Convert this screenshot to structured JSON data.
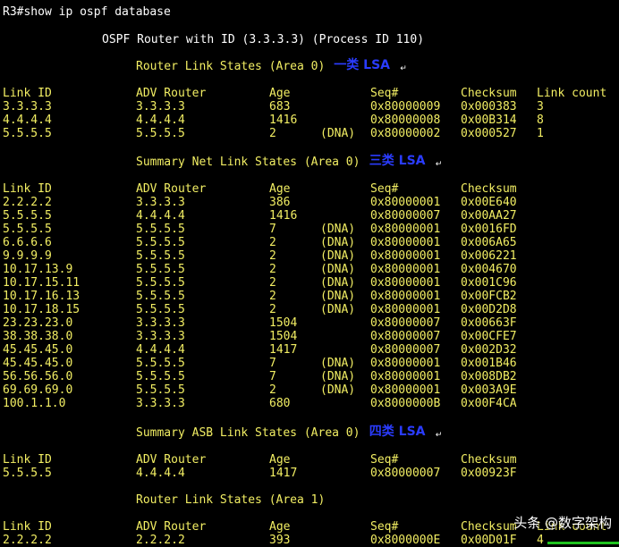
{
  "prompt": "R3#show ip ospf database",
  "title": "OSPF Router with ID (3.3.3.3) (Process ID 110)",
  "mark": "↵",
  "watermark": "头条 @数字架构",
  "sections": [
    {
      "heading": "Router Link States (Area 0)",
      "note": "一类 LSA",
      "columns": [
        "Link ID",
        "ADV Router",
        "Age",
        "Seq#",
        "Checksum",
        "Link count"
      ],
      "rows": [
        {
          "link_id": "3.3.3.3",
          "adv": "3.3.3.3",
          "age": "683",
          "dna": "",
          "seq": "0x80000009",
          "checksum": "0x000383",
          "count": "3"
        },
        {
          "link_id": "4.4.4.4",
          "adv": "4.4.4.4",
          "age": "1416",
          "dna": "",
          "seq": "0x80000008",
          "checksum": "0x00B314",
          "count": "8"
        },
        {
          "link_id": "5.5.5.5",
          "adv": "5.5.5.5",
          "age": "2",
          "dna": "(DNA)",
          "seq": "0x80000002",
          "checksum": "0x000527",
          "count": "1"
        }
      ]
    },
    {
      "heading": "Summary Net Link States (Area 0)",
      "note": "三类 LSA",
      "columns": [
        "Link ID",
        "ADV Router",
        "Age",
        "Seq#",
        "Checksum"
      ],
      "rows": [
        {
          "link_id": "2.2.2.2",
          "adv": "3.3.3.3",
          "age": "386",
          "dna": "",
          "seq": "0x80000001",
          "checksum": "0x00E640"
        },
        {
          "link_id": "5.5.5.5",
          "adv": "4.4.4.4",
          "age": "1416",
          "dna": "",
          "seq": "0x80000007",
          "checksum": "0x00AA27"
        },
        {
          "link_id": "5.5.5.5",
          "adv": "5.5.5.5",
          "age": "7",
          "dna": "(DNA)",
          "seq": "0x80000001",
          "checksum": "0x0016FD"
        },
        {
          "link_id": "6.6.6.6",
          "adv": "5.5.5.5",
          "age": "2",
          "dna": "(DNA)",
          "seq": "0x80000001",
          "checksum": "0x006A65"
        },
        {
          "link_id": "9.9.9.9",
          "adv": "5.5.5.5",
          "age": "2",
          "dna": "(DNA)",
          "seq": "0x80000001",
          "checksum": "0x006221"
        },
        {
          "link_id": "10.17.13.9",
          "adv": "5.5.5.5",
          "age": "2",
          "dna": "(DNA)",
          "seq": "0x80000001",
          "checksum": "0x004670"
        },
        {
          "link_id": "10.17.15.11",
          "adv": "5.5.5.5",
          "age": "2",
          "dna": "(DNA)",
          "seq": "0x80000001",
          "checksum": "0x001C96"
        },
        {
          "link_id": "10.17.16.13",
          "adv": "5.5.5.5",
          "age": "2",
          "dna": "(DNA)",
          "seq": "0x80000001",
          "checksum": "0x00FCB2"
        },
        {
          "link_id": "10.17.18.15",
          "adv": "5.5.5.5",
          "age": "2",
          "dna": "(DNA)",
          "seq": "0x80000001",
          "checksum": "0x00D2D8"
        },
        {
          "link_id": "23.23.23.0",
          "adv": "3.3.3.3",
          "age": "1504",
          "dna": "",
          "seq": "0x80000007",
          "checksum": "0x00663F"
        },
        {
          "link_id": "38.38.38.0",
          "adv": "3.3.3.3",
          "age": "1504",
          "dna": "",
          "seq": "0x80000007",
          "checksum": "0x00CFE7"
        },
        {
          "link_id": "45.45.45.0",
          "adv": "4.4.4.4",
          "age": "1417",
          "dna": "",
          "seq": "0x80000007",
          "checksum": "0x002D32"
        },
        {
          "link_id": "45.45.45.0",
          "adv": "5.5.5.5",
          "age": "7",
          "dna": "(DNA)",
          "seq": "0x80000001",
          "checksum": "0x001B46"
        },
        {
          "link_id": "56.56.56.0",
          "adv": "5.5.5.5",
          "age": "7",
          "dna": "(DNA)",
          "seq": "0x80000001",
          "checksum": "0x008DB2"
        },
        {
          "link_id": "69.69.69.0",
          "adv": "5.5.5.5",
          "age": "2",
          "dna": "(DNA)",
          "seq": "0x80000001",
          "checksum": "0x003A9E"
        },
        {
          "link_id": "100.1.1.0",
          "adv": "3.3.3.3",
          "age": "680",
          "dna": "",
          "seq": "0x8000000B",
          "checksum": "0x00F4CA"
        }
      ]
    },
    {
      "heading": "Summary ASB Link States (Area 0)",
      "note": "四类 LSA",
      "columns": [
        "Link ID",
        "ADV Router",
        "Age",
        "Seq#",
        "Checksum"
      ],
      "rows": [
        {
          "link_id": "5.5.5.5",
          "adv": "4.4.4.4",
          "age": "1417",
          "dna": "",
          "seq": "0x80000007",
          "checksum": "0x00923F"
        }
      ]
    },
    {
      "heading": "Router Link States (Area 1)",
      "note": "",
      "columns": [
        "Link ID",
        "ADV Router",
        "Age",
        "Seq#",
        "Checksum",
        "Link count"
      ],
      "rows": [
        {
          "link_id": "2.2.2.2",
          "adv": "2.2.2.2",
          "age": "393",
          "dna": "",
          "seq": "0x8000000E",
          "checksum": "0x00D01F",
          "count": "4"
        }
      ]
    }
  ]
}
